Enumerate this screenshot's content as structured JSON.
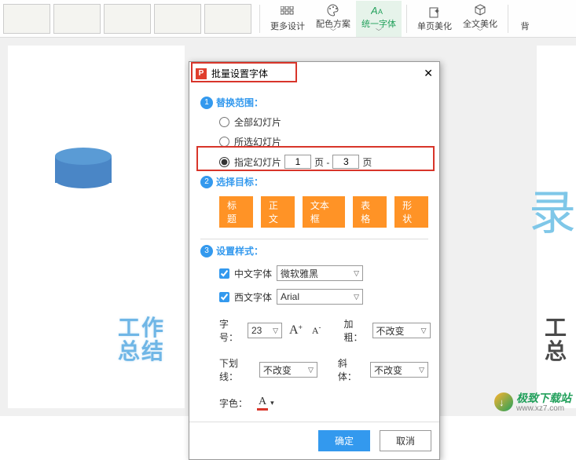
{
  "toolbar": {
    "more_design": "更多设计",
    "color_scheme": "配色方案",
    "unify_font": "统一字体",
    "single_beautify": "单页美化",
    "full_beautify": "全文美化",
    "back": "背"
  },
  "slide": {
    "label_left_line1": "工作",
    "label_left_line2": "总结",
    "right_char": "录",
    "right_label_line1": "工",
    "right_label_line2": "总"
  },
  "dialog": {
    "title": "批量设置字体",
    "step1_label": "替换范围：",
    "opt_all": "全部幻灯片",
    "opt_selected": "所选幻灯片",
    "opt_range": "指定幻灯片",
    "page_from": "1",
    "page_sep": "页 -",
    "page_to": "3",
    "page_unit": "页",
    "step2_label": "选择目标：",
    "tags": {
      "title": "标题",
      "body": "正文",
      "textbox": "文本框",
      "table": "表格",
      "shape": "形状"
    },
    "step3_label": "设置样式：",
    "cn_font_label": "中文字体",
    "cn_font_value": "微软雅黑",
    "en_font_label": "西文字体",
    "en_font_value": "Arial",
    "size_label": "字号：",
    "size_value": "23",
    "bold_label": "加粗：",
    "bold_value": "不改变",
    "underline_label": "下划线：",
    "underline_value": "不改变",
    "italic_label": "斜体：",
    "italic_value": "不改变",
    "color_label": "字色：",
    "ok": "确定",
    "cancel": "取消"
  },
  "watermark": {
    "name": "极致下载站",
    "url": "www.xz7.com"
  }
}
